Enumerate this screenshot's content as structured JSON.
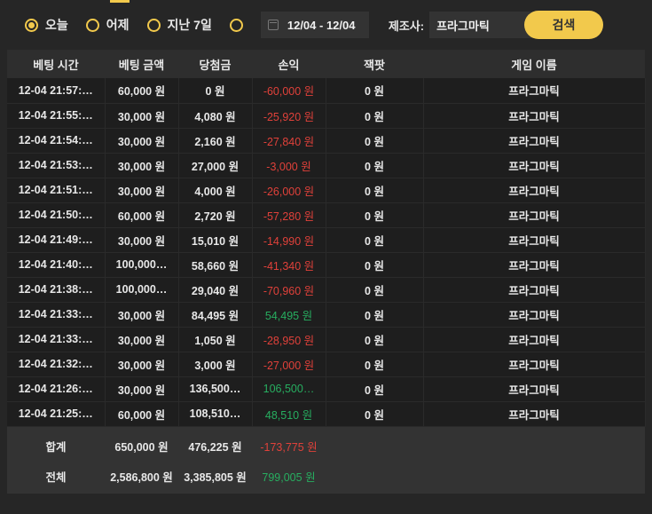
{
  "filters": {
    "today": "오늘",
    "yesterday": "어제",
    "last7": "지난 7일",
    "date_range": "12/04 - 12/04",
    "maker_label": "제조사:",
    "maker_value": "프라그마틱",
    "search_label": "검색"
  },
  "columns": [
    "베팅 시간",
    "베팅 금액",
    "당첨금",
    "손익",
    "잭팟",
    "게임 이름"
  ],
  "rows": [
    {
      "time": "12-04 21:57:…",
      "bet": "60,000 원",
      "win": "0 원",
      "pl": "-60,000 원",
      "pl_sign": "neg",
      "jackpot": "0 원",
      "game": "프라그마틱"
    },
    {
      "time": "12-04 21:55:…",
      "bet": "30,000 원",
      "win": "4,080 원",
      "pl": "-25,920 원",
      "pl_sign": "neg",
      "jackpot": "0 원",
      "game": "프라그마틱"
    },
    {
      "time": "12-04 21:54:…",
      "bet": "30,000 원",
      "win": "2,160 원",
      "pl": "-27,840 원",
      "pl_sign": "neg",
      "jackpot": "0 원",
      "game": "프라그마틱"
    },
    {
      "time": "12-04 21:53:…",
      "bet": "30,000 원",
      "win": "27,000 원",
      "pl": "-3,000 원",
      "pl_sign": "neg",
      "jackpot": "0 원",
      "game": "프라그마틱"
    },
    {
      "time": "12-04 21:51:…",
      "bet": "30,000 원",
      "win": "4,000 원",
      "pl": "-26,000 원",
      "pl_sign": "neg",
      "jackpot": "0 원",
      "game": "프라그마틱"
    },
    {
      "time": "12-04 21:50:…",
      "bet": "60,000 원",
      "win": "2,720 원",
      "pl": "-57,280 원",
      "pl_sign": "neg",
      "jackpot": "0 원",
      "game": "프라그마틱"
    },
    {
      "time": "12-04 21:49:…",
      "bet": "30,000 원",
      "win": "15,010 원",
      "pl": "-14,990 원",
      "pl_sign": "neg",
      "jackpot": "0 원",
      "game": "프라그마틱"
    },
    {
      "time": "12-04 21:40:…",
      "bet": "100,000…",
      "win": "58,660 원",
      "pl": "-41,340 원",
      "pl_sign": "neg",
      "jackpot": "0 원",
      "game": "프라그마틱"
    },
    {
      "time": "12-04 21:38:…",
      "bet": "100,000…",
      "win": "29,040 원",
      "pl": "-70,960 원",
      "pl_sign": "neg",
      "jackpot": "0 원",
      "game": "프라그마틱"
    },
    {
      "time": "12-04 21:33:…",
      "bet": "30,000 원",
      "win": "84,495 원",
      "pl": "54,495 원",
      "pl_sign": "pos",
      "jackpot": "0 원",
      "game": "프라그마틱"
    },
    {
      "time": "12-04 21:33:…",
      "bet": "30,000 원",
      "win": "1,050 원",
      "pl": "-28,950 원",
      "pl_sign": "neg",
      "jackpot": "0 원",
      "game": "프라그마틱"
    },
    {
      "time": "12-04 21:32:…",
      "bet": "30,000 원",
      "win": "3,000 원",
      "pl": "-27,000 원",
      "pl_sign": "neg",
      "jackpot": "0 원",
      "game": "프라그마틱"
    },
    {
      "time": "12-04 21:26:…",
      "bet": "30,000 원",
      "win": "136,500…",
      "pl": "106,500…",
      "pl_sign": "pos",
      "jackpot": "0 원",
      "game": "프라그마틱"
    },
    {
      "time": "12-04 21:25:…",
      "bet": "60,000 원",
      "win": "108,510…",
      "pl": "48,510 원",
      "pl_sign": "pos",
      "jackpot": "0 원",
      "game": "프라그마틱"
    }
  ],
  "summary": {
    "subtotal": {
      "label": "합계",
      "bet": "650,000 원",
      "win": "476,225 원",
      "pl": "-173,775 원",
      "pl_sign": "neg"
    },
    "total": {
      "label": "전체",
      "bet": "2,586,800 원",
      "win": "3,385,805 원",
      "pl": "799,005 원",
      "pl_sign": "pos"
    }
  },
  "colors": {
    "accent": "#f2c94c",
    "negative": "#e0413a",
    "positive": "#27ae60",
    "background": "#262626"
  }
}
